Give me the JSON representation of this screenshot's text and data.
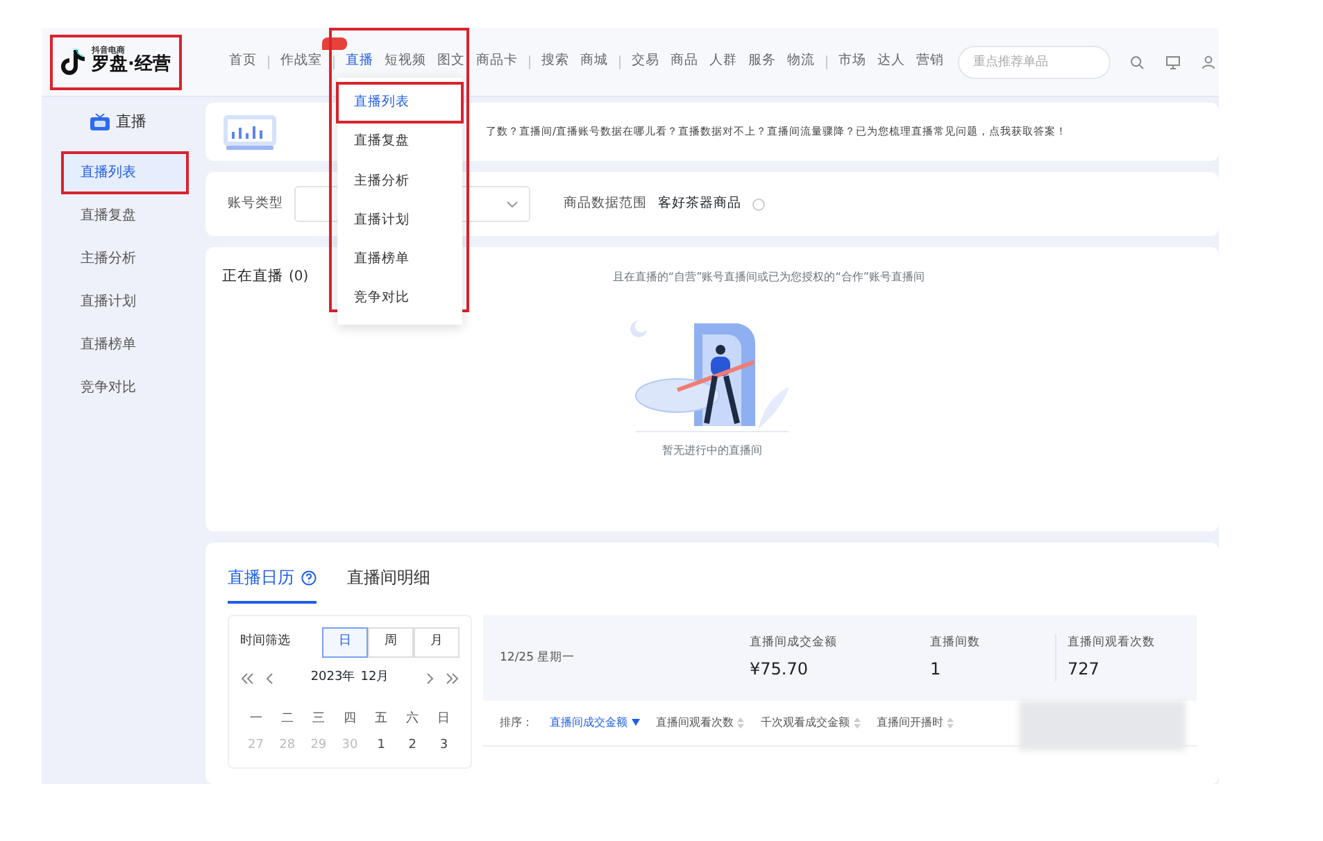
{
  "logo": {
    "caption": "抖音电商",
    "title": "罗盘·经营",
    "highlighted": true
  },
  "nav_groups": [
    [
      {
        "label": "首页",
        "selected": false
      }
    ],
    [
      {
        "label": "作战室",
        "selected": false,
        "badge": true
      }
    ],
    [
      {
        "label": "直播",
        "selected": true
      },
      {
        "label": "短视频",
        "selected": false
      },
      {
        "label": "图文",
        "selected": false
      },
      {
        "label": "商品卡",
        "selected": false
      }
    ],
    [
      {
        "label": "搜索",
        "selected": false
      },
      {
        "label": "商城",
        "selected": false
      }
    ],
    [
      {
        "label": "交易",
        "selected": false
      },
      {
        "label": "商品",
        "selected": false
      },
      {
        "label": "人群",
        "selected": false
      },
      {
        "label": "服务",
        "selected": false
      },
      {
        "label": "物流",
        "selected": false
      }
    ],
    [
      {
        "label": "市场",
        "selected": false
      },
      {
        "label": "达人",
        "selected": false
      },
      {
        "label": "营销",
        "selected": false
      }
    ]
  ],
  "search": {
    "placeholder": "重点推荐单品"
  },
  "dropdown": {
    "highlighted": true,
    "items": [
      {
        "label": "直播列表",
        "selected": true,
        "highlighted": true
      },
      {
        "label": "直播复盘",
        "selected": false,
        "highlighted": false
      },
      {
        "label": "主播分析",
        "selected": false,
        "highlighted": false
      },
      {
        "label": "直播计划",
        "selected": false,
        "highlighted": false
      },
      {
        "label": "直播榜单",
        "selected": false,
        "highlighted": false
      },
      {
        "label": "竞争对比",
        "selected": false,
        "highlighted": false
      }
    ]
  },
  "sidebar": {
    "title": "直播",
    "items": [
      {
        "label": "直播列表",
        "selected": true,
        "highlighted": true
      },
      {
        "label": "直播复盘",
        "selected": false,
        "highlighted": false
      },
      {
        "label": "主播分析",
        "selected": false,
        "highlighted": false
      },
      {
        "label": "直播计划",
        "selected": false,
        "highlighted": false
      },
      {
        "label": "直播榜单",
        "selected": false,
        "highlighted": false
      },
      {
        "label": "竞争对比",
        "selected": false,
        "highlighted": false
      }
    ]
  },
  "banner": {
    "text": "了数？直播间/直播账号数据在哪儿看？直播数据对不上？直播间流量骤降？已为您梳理直播常见问题，点我获取答案！"
  },
  "filters": {
    "account_type_label": "账号类型",
    "range_label": "商品数据范围",
    "range_value": "客好茶器商品"
  },
  "live_now": {
    "title": "正在直播",
    "count": "(0)",
    "hint": "且在直播的“自营”账号直播间或已为您授权的“合作”账号直播间",
    "empty_text": "暂无进行中的直播间"
  },
  "tabs": [
    {
      "label": "直播日历",
      "selected": true,
      "help": true
    },
    {
      "label": "直播间明细",
      "selected": false,
      "help": false
    }
  ],
  "calendar": {
    "filter_label": "时间筛选",
    "periods": [
      {
        "label": "日",
        "selected": true
      },
      {
        "label": "周",
        "selected": false
      },
      {
        "label": "月",
        "selected": false
      }
    ],
    "year": "2023年",
    "month": "12月",
    "weekdays": [
      "一",
      "二",
      "三",
      "四",
      "五",
      "六",
      "日"
    ],
    "days": [
      {
        "label": "27",
        "muted": true
      },
      {
        "label": "28",
        "muted": true
      },
      {
        "label": "29",
        "muted": true
      },
      {
        "label": "30",
        "muted": true
      },
      {
        "label": "1",
        "muted": false
      },
      {
        "label": "2",
        "muted": false
      },
      {
        "label": "3",
        "muted": false
      }
    ]
  },
  "summary": {
    "date": "12/25 星期一",
    "metrics": [
      {
        "label": "直播间成交金额",
        "value": "¥75.70"
      },
      {
        "label": "直播间数",
        "value": "1"
      },
      {
        "label": "直播间观看次数",
        "value": "727"
      }
    ]
  },
  "sort": {
    "label": "排序：",
    "options": [
      {
        "label": "直播间成交金额",
        "selected": true
      },
      {
        "label": "直播间观看次数",
        "selected": false
      },
      {
        "label": "千次观看成交金额",
        "selected": false
      },
      {
        "label": "直播间开播时",
        "selected": false
      }
    ]
  }
}
